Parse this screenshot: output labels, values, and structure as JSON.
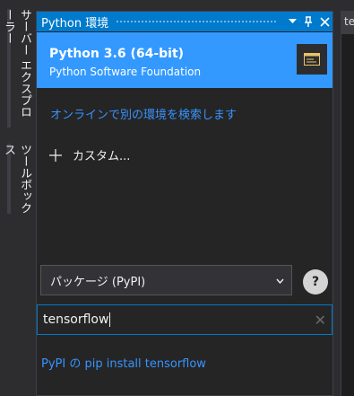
{
  "sidebar": {
    "tabs": [
      {
        "label": "サーバー エクスプローラー"
      },
      {
        "label": "ツールボックス"
      }
    ]
  },
  "panel": {
    "title": "Python 環境",
    "header_icons": [
      "dropdown-arrow-icon",
      "pin-icon",
      "close-icon"
    ],
    "environment": {
      "name": "Python 3.6 (64-bit)",
      "vendor": "Python Software Foundation"
    },
    "search_online_link": "オンラインで別の環境を検索します",
    "custom_label": "カスタム...",
    "package_source": {
      "selected": "パッケージ (PyPI)"
    },
    "help_label": "?",
    "search": {
      "value": "tensorflow"
    },
    "pip_install_link": "PyPI の pip install tensorflow"
  },
  "right_panel": {
    "tab_label": "te"
  },
  "colors": {
    "accent": "#007acc",
    "selection": "#3399ff",
    "link": "#3794ff",
    "background": "#252526"
  }
}
